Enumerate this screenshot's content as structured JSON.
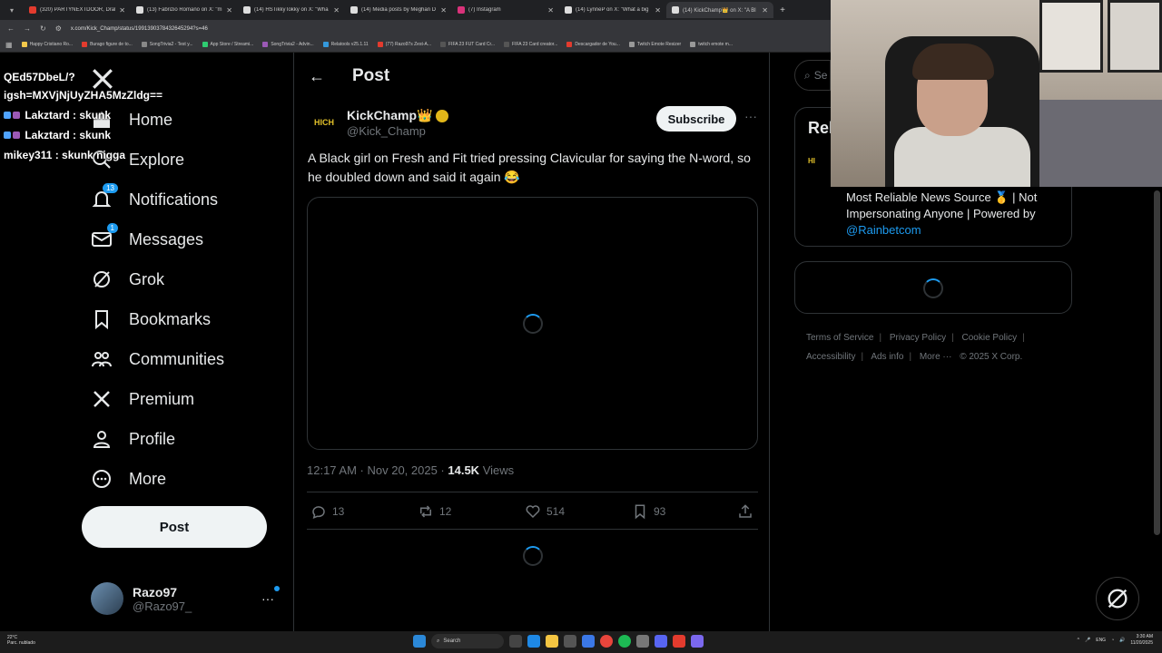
{
  "browser": {
    "tabs": [
      {
        "label": "(320) PARTYNEXTDOOR, Drake",
        "color": "#e33b2e"
      },
      {
        "label": "(13) Fabrizio Romano on X: \"m",
        "color": "#ffffff"
      },
      {
        "label": "(14) HSTikkyTokky on X: \"Wha",
        "color": "#ffffff"
      },
      {
        "label": "(14) Media posts by Meghan D",
        "color": "#ffffff"
      },
      {
        "label": "(7) Instagram",
        "color": "#d9327a"
      },
      {
        "label": "(14) LynneP on X: \"What a big",
        "color": "#ffffff"
      },
      {
        "label": "(14) KickChamp👑 on X: \"A Bl",
        "color": "#ffffff"
      }
    ],
    "url": "x.com/Kick_Champ/status/1991390378432645294?s=46",
    "bookmarks": [
      "Happy Cristiano Ro...",
      "Burago figure de to...",
      "SongTrivia2 - Test y...",
      "App Store / Streami...",
      "SongTrivia2 - Advin...",
      "Relatools v25.1.11",
      "(77) Razo97s Zest-A...",
      "FIFA 23 FUT Card Cr...",
      "FIFA 23 Card creator...",
      "Descargador de You...",
      "Twitch Emote Resizer",
      "twitch emote m..."
    ]
  },
  "chat": {
    "lines": [
      "QEd57DbeL/?",
      "igsh=MXVjNjUyZHA5MzZldg==",
      "Lakztard : skunk",
      "Lakztard : skunk",
      "mikey311 : skunk nigga"
    ]
  },
  "nav": {
    "home": "Home",
    "explore": "Explore",
    "notifications": "Notifications",
    "notifications_badge": "13",
    "messages": "Messages",
    "messages_badge": "1",
    "grok": "Grok",
    "bookmarks": "Bookmarks",
    "communities": "Communities",
    "premium": "Premium",
    "profile": "Profile",
    "more": "More",
    "post_button": "Post"
  },
  "account": {
    "name": "Razo97",
    "handle": "@Razo97_"
  },
  "main": {
    "header_title": "Post",
    "author_name": "KickChamp👑",
    "author_handle": "@Kick_Champ",
    "author_avatar_text": "HICH",
    "subscribe_label": "Subscribe",
    "text": "A Black girl on Fresh and Fit tried pressing Clavicular for saying the N-word, so he doubled down and said it again 😂",
    "timestamp": "12:17 AM · Nov 20, 2025",
    "views_count": "14.5K",
    "views_label": "Views",
    "replies": "13",
    "reposts": "12",
    "likes": "514",
    "bookmarks": "93"
  },
  "right": {
    "search_placeholder": "Se",
    "relevant_header": "Rel",
    "bio_text": "Most Reliable News Source 🥇 | Not Impersonating Anyone | Powered by",
    "bio_link": "@Rainbetcom",
    "footer": [
      "Terms of Service",
      "Privacy Policy",
      "Cookie Policy",
      "Accessibility",
      "Ads info",
      "More ···",
      "© 2025 X Corp."
    ]
  },
  "taskbar": {
    "weather_temp": "22°C",
    "weather_desc": "Parc. nublado",
    "search_label": "Search",
    "lang": "ENG",
    "time": "3:30 AM",
    "date": "11/20/2025"
  },
  "colors": {
    "accent": "#1d9bf0",
    "muted": "#71767b",
    "text": "#e7e9ea",
    "border": "#2f3336"
  }
}
